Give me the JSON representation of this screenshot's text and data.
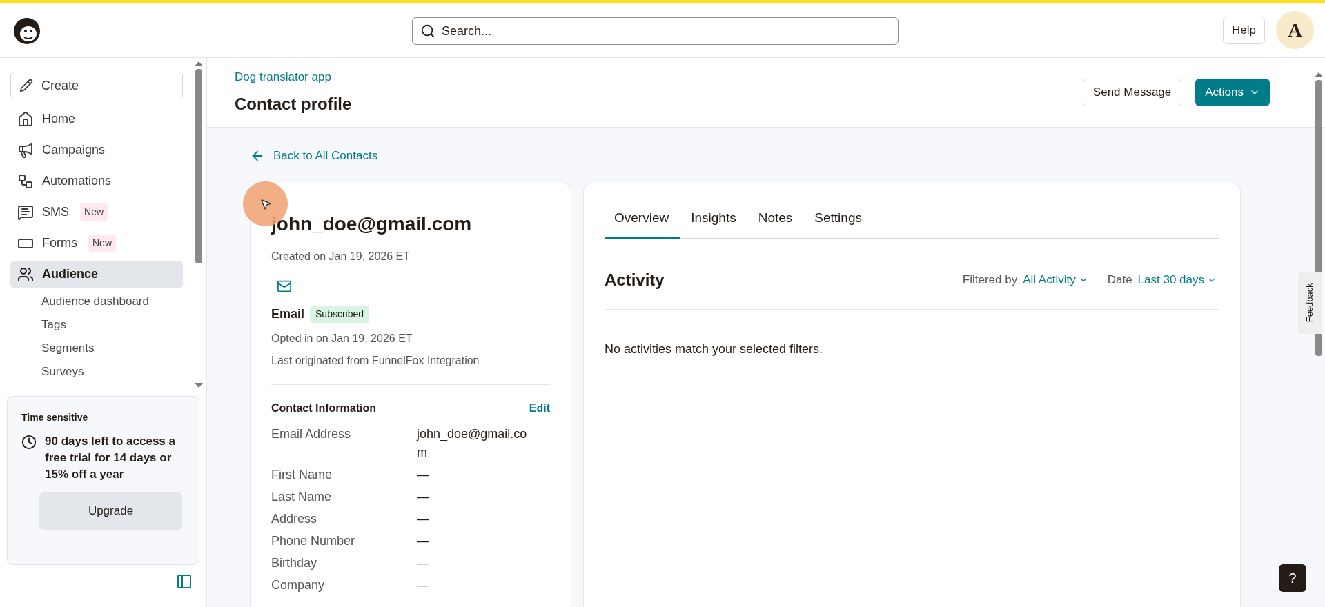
{
  "header": {
    "search": {
      "placeholder": "Search..."
    },
    "help": "Help",
    "avatar": "A"
  },
  "sidebar": {
    "create": "Create",
    "items": [
      {
        "label": "Home",
        "selected": false
      },
      {
        "label": "Campaigns",
        "selected": false
      },
      {
        "label": "Automations",
        "selected": false
      },
      {
        "label": "SMS",
        "badge": "New",
        "selected": false
      },
      {
        "label": "Forms",
        "badge": "New",
        "selected": false
      },
      {
        "label": "Audience",
        "selected": true,
        "children": [
          {
            "label": "Audience dashboard"
          },
          {
            "label": "Tags"
          },
          {
            "label": "Segments"
          },
          {
            "label": "Surveys"
          }
        ]
      }
    ],
    "promo": {
      "title": "Time sensitive",
      "text": "90 days left to access a free trial for 14 days or 15% off a year",
      "button": "Upgrade"
    }
  },
  "page": {
    "breadcrumb": "Dog translator app",
    "title": "Contact profile",
    "buttons": [
      "Send Message",
      "Actions"
    ],
    "back": "Back to All Contacts"
  },
  "contact": {
    "email": "john_doe@gmail.com",
    "created": "Created on Jan 19, 2026 ET",
    "channel": "Email",
    "status": "Subscribed",
    "opted": "Opted in on Jan 19, 2026 ET",
    "origin": "Last originated from FunnelFox Integration",
    "section": "Contact Information",
    "edit": "Edit",
    "fields": [
      {
        "label": "Email Address",
        "value": "john_doe@gmail.com"
      },
      {
        "label": "First Name",
        "value": "—"
      },
      {
        "label": "Last Name",
        "value": "—"
      },
      {
        "label": "Address",
        "value": "—"
      },
      {
        "label": "Phone Number",
        "value": "—"
      },
      {
        "label": "Birthday",
        "value": "—"
      },
      {
        "label": "Company",
        "value": "—"
      }
    ]
  },
  "tabs": [
    {
      "label": "Overview",
      "selected": true
    },
    {
      "label": "Insights",
      "selected": false
    },
    {
      "label": "Notes",
      "selected": false
    },
    {
      "label": "Settings",
      "selected": false
    }
  ],
  "activity": {
    "title": "Activity",
    "filter_label": "Filtered by",
    "filter_value": "All Activity",
    "date_label": "Date",
    "date_value": "Last 30 days",
    "empty": "No activities match your selected filters."
  },
  "feedback": "Feedback",
  "help_fab": "?"
}
